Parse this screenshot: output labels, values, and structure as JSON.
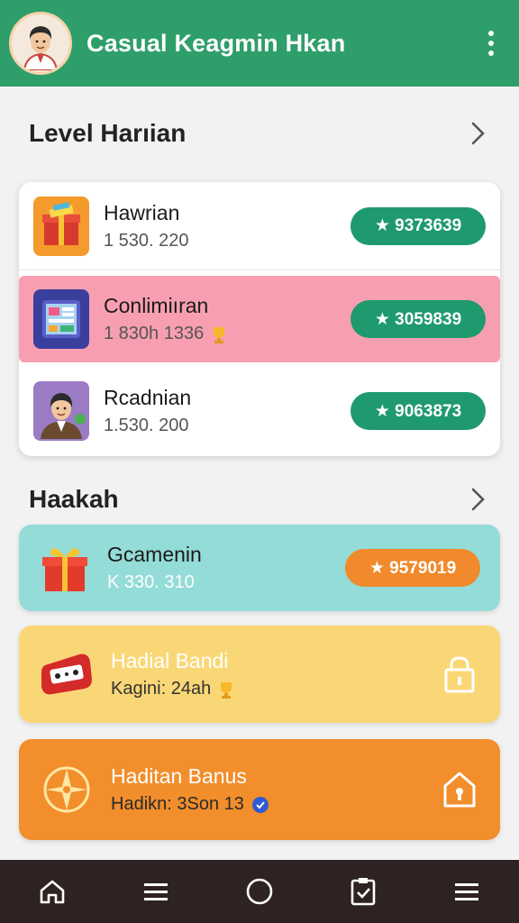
{
  "app": {
    "title": "Casual Keagmin Hkan",
    "header_color": "#2e9e6a"
  },
  "section_daily": {
    "title": "Level Harıian",
    "items": [
      {
        "title": "Hawrian",
        "subtitle": "1 530. 220",
        "reward": "★ 9373639",
        "icon": "gift-box-icon",
        "highlight": false
      },
      {
        "title": "Conlimiıran",
        "subtitle": "1 830h 1336",
        "reward": "★ 3059839",
        "icon": "tablet-app-icon",
        "highlight": true,
        "highlight_color": "#f79fb0"
      },
      {
        "title": "Rcadnian",
        "subtitle": "1.530. 200",
        "reward": "★ 9063873",
        "icon": "avatar-icon",
        "highlight": false
      }
    ]
  },
  "section_rewards": {
    "title": "Haakah",
    "items": [
      {
        "title": "Gcamenin",
        "subtitle": "K 330. 310",
        "reward": "★ 9579019",
        "color": "#94dcd8",
        "reward_color": "#f08a2c",
        "icon": "gift-box-icon"
      },
      {
        "title": "Hadial Bandi",
        "subtitle": "Kagini: 24ah",
        "color": "#fad776",
        "icon": "game-controller-icon",
        "locked": true
      },
      {
        "title": "Haditan Banus",
        "subtitle": "Hadikn: 3Son 13",
        "color": "#f28e2b",
        "icon": "compass-icon",
        "locked": true
      }
    ]
  },
  "bottom_nav": [
    "home-icon",
    "menu-icon",
    "circle-icon",
    "clipboard-icon",
    "menu-icon"
  ]
}
